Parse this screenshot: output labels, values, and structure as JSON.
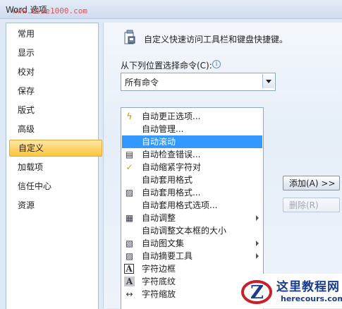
{
  "window": {
    "title": "Word 选项",
    "watermark": "www.blue1000.com"
  },
  "sidebar": {
    "items": [
      {
        "label": "常用"
      },
      {
        "label": "显示"
      },
      {
        "label": "校对"
      },
      {
        "label": "保存"
      },
      {
        "label": "版式"
      },
      {
        "label": "高级"
      },
      {
        "label": "自定义",
        "active": true
      },
      {
        "label": "加载项"
      },
      {
        "label": "信任中心"
      },
      {
        "label": "资源"
      }
    ]
  },
  "main": {
    "header": "自定义快速访问工具栏和键盘快捷键。",
    "choose_label": "从下列位置选择命令(C):",
    "info_glyph": "i",
    "choose_value": "所有命令",
    "commands": [
      {
        "label": "自动更正选项...",
        "icon": "lightning-icon",
        "glyph": "ϟ"
      },
      {
        "label": "自动管理...",
        "icon": "",
        "glyph": ""
      },
      {
        "label": "自动滚动",
        "icon": "",
        "glyph": "",
        "selected": true
      },
      {
        "label": "自动检查错误...",
        "icon": "check-error-icon",
        "glyph": "▤"
      },
      {
        "label": "自动缩紧字符对",
        "icon": "checkmark-icon",
        "glyph": "✓"
      },
      {
        "label": "自动套用格式",
        "icon": "",
        "glyph": ""
      },
      {
        "label": "自动套用格式...",
        "icon": "autoformat-icon",
        "glyph": "▨"
      },
      {
        "label": "自动套用格式选项...",
        "icon": "",
        "glyph": ""
      },
      {
        "label": "自动调整",
        "icon": "autofit-icon",
        "glyph": "▦",
        "submenu": true
      },
      {
        "label": "自动调整文本框的大小",
        "icon": "",
        "glyph": ""
      },
      {
        "label": "自动图文集",
        "icon": "autotext-icon",
        "glyph": "▧",
        "submenu": true
      },
      {
        "label": "自动摘要工具",
        "icon": "summary-icon",
        "glyph": "▨",
        "submenu": true
      },
      {
        "label": "字符边框",
        "icon": "char-border-icon",
        "glyph": "A"
      },
      {
        "label": "字符底纹",
        "icon": "char-shading-icon",
        "glyph": "A"
      },
      {
        "label": "字符缩放",
        "icon": "char-scale-icon",
        "glyph": "↔"
      }
    ],
    "add_button": "添加(A) >>",
    "remove_button": "删除(R)"
  },
  "logo": {
    "name": "这里教程网",
    "url": "herecours.com"
  },
  "colors": {
    "selection": "#3399ff",
    "active_tab": "#ffd46e"
  }
}
